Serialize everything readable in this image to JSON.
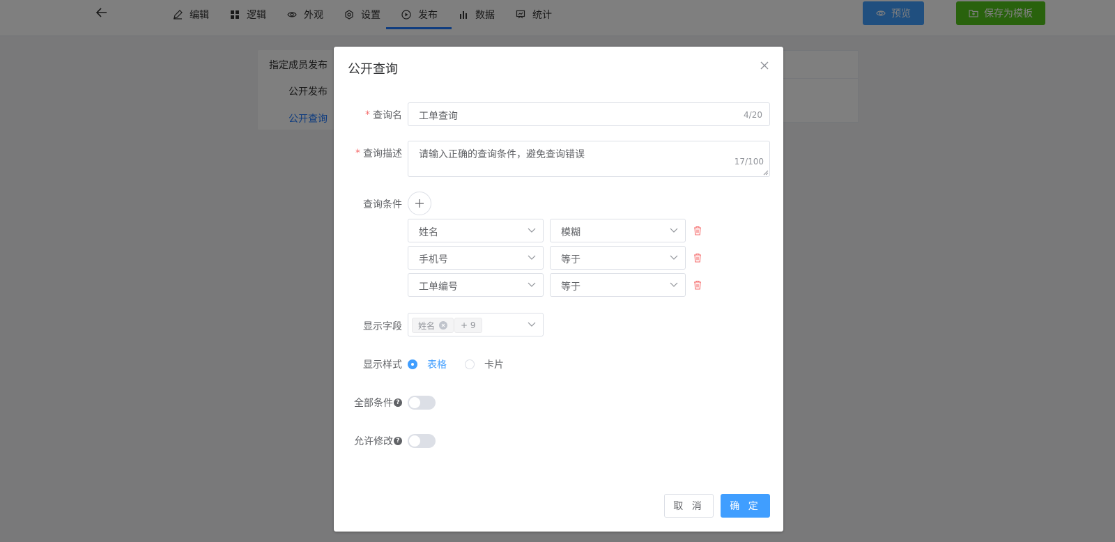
{
  "topbar": {
    "nav": [
      {
        "label": "编辑",
        "icon": "edit-icon"
      },
      {
        "label": "逻辑",
        "icon": "grid-icon"
      },
      {
        "label": "外观",
        "icon": "eye-icon"
      },
      {
        "label": "设置",
        "icon": "gear-icon"
      },
      {
        "label": "发布",
        "icon": "play-circle-icon",
        "active": true
      },
      {
        "label": "数据",
        "icon": "bar-chart-icon"
      },
      {
        "label": "统计",
        "icon": "presentation-icon"
      }
    ],
    "preview_label": "预览",
    "save_template_label": "保存为模板"
  },
  "sidebar": {
    "items": [
      {
        "label": "指定成员发布"
      },
      {
        "label": "公开发布"
      },
      {
        "label": "公开查询",
        "active": true
      }
    ]
  },
  "dialog": {
    "title": "公开查询",
    "query_name": {
      "label": "查询名",
      "value": "工单查询",
      "count": "4/20"
    },
    "query_desc": {
      "label": "查询描述",
      "value": "请输入正确的查询条件，避免查询错误",
      "count": "17/100"
    },
    "conditions": {
      "label": "查询条件",
      "rows": [
        {
          "field": "姓名",
          "op": "模糊"
        },
        {
          "field": "手机号",
          "op": "等于"
        },
        {
          "field": "工单编号",
          "op": "等于"
        }
      ]
    },
    "display_fields": {
      "label": "显示字段",
      "tag": "姓名",
      "more": "+ 9"
    },
    "display_style": {
      "label": "显示样式",
      "options": [
        "表格",
        "卡片"
      ],
      "selected": "表格"
    },
    "all_conditions": {
      "label": "全部条件",
      "on": false
    },
    "allow_edit": {
      "label": "允许修改",
      "on": false
    },
    "cancel_label": "取 消",
    "ok_label": "确 定"
  },
  "colors": {
    "primary": "#409eff",
    "success": "#52c41a",
    "danger": "#f56c6c"
  }
}
